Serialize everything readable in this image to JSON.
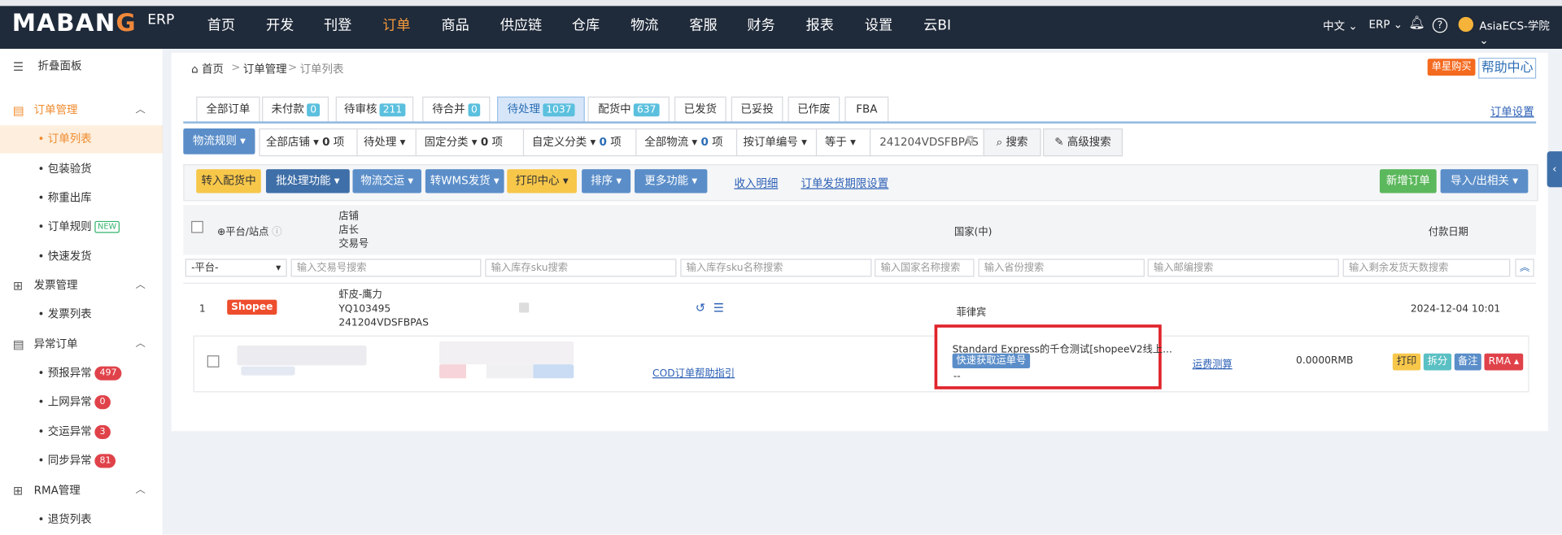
{
  "header": {
    "logo_text": "MABANG",
    "logo_suffix": "ERP",
    "nav": [
      "首页",
      "开发",
      "刊登",
      "订单",
      "商品",
      "供应链",
      "仓库",
      "物流",
      "客服",
      "财务",
      "报表",
      "设置",
      "云BI"
    ],
    "active_nav": "订单",
    "lang": "中文",
    "erp_menu": "ERP",
    "user": "AsiaECS-学院"
  },
  "sidebar": {
    "collapse_label": "折叠面板",
    "groups": [
      {
        "label": "订单管理",
        "items": [
          "订单列表",
          "包装验货",
          "称重出库",
          "订单规则",
          "快速发货"
        ],
        "new_tag": "NEW"
      },
      {
        "label": "发票管理",
        "items": [
          "发票列表"
        ]
      },
      {
        "label": "异常订单",
        "items": [
          {
            "label": "预报异常",
            "count": "497"
          },
          {
            "label": "上网异常",
            "count": "0"
          },
          {
            "label": "交运异常",
            "count": "3"
          },
          {
            "label": "同步异常",
            "count": "81"
          }
        ]
      },
      {
        "label": "RMA管理",
        "items": [
          "退货列表"
        ]
      }
    ]
  },
  "breadcrumb": [
    "首页",
    "订单管理",
    "订单列表"
  ],
  "top_actions": {
    "buy_label": "单星购买",
    "help_label": "帮助中心"
  },
  "tabs": [
    {
      "label": "全部订单"
    },
    {
      "label": "未付款",
      "count": "0"
    },
    {
      "label": "待审核",
      "count": "211"
    },
    {
      "label": "待合并",
      "count": "0"
    },
    {
      "label": "待处理",
      "count": "1037"
    },
    {
      "label": "配货中",
      "count": "637"
    },
    {
      "label": "已发货"
    },
    {
      "label": "已妥投"
    },
    {
      "label": "已作废"
    },
    {
      "label": "FBA"
    }
  ],
  "order_settings_link": "订单设置",
  "filters": {
    "logistics_rule": "物流规则",
    "all_shops": "全部店铺",
    "shops_count": "0",
    "unit": "项",
    "status": "待处理",
    "fixed_category": "固定分类",
    "fixed_count": "0",
    "custom_category": "自定义分类",
    "custom_count": "0",
    "all_logistics": "全部物流",
    "logistics_count": "0",
    "search_by": "按订单编号",
    "operator": "等于",
    "search_value": "241204VDSFBPAS",
    "search_btn": "搜索",
    "advanced_btn": "高级搜索"
  },
  "actions": {
    "to_picking": "转入配货中",
    "batch": "批处理功能",
    "logistics_ship": "物流交运",
    "wms_ship": "转WMS发货",
    "print_center": "打印中心",
    "sort": "排序",
    "more": "更多功能",
    "income_detail": "收入明细",
    "deadline_setting": "订单发货期限设置",
    "new_order": "新增订单",
    "import_export": "导入/出相关"
  },
  "table": {
    "col_platform": "平台/站点",
    "col_shop": [
      "店铺",
      "店长",
      "交易号"
    ],
    "col_country": "国家(中)",
    "col_paydate": "付款日期",
    "filter_platform": "-平台-",
    "placeholders": [
      "输入交易号搜索",
      "输入库存sku搜索",
      "输入库存sku名称搜索",
      "输入国家名称搜索",
      "输入省份搜索",
      "输入邮编搜索",
      "输入剩余发货天数搜索"
    ]
  },
  "order": {
    "index": "1",
    "platform": "Shopee",
    "shop": "虾皮-鹰力",
    "manager": "YQ103495",
    "trade_no": "241204VDSFBPAS",
    "country": "菲律宾",
    "paid_at": "2024-12-04 10:01",
    "cod_link": "COD订单帮助指引",
    "shipping_method": "Standard Express的千仓测试[shopeeV2线上...",
    "get_tracking_btn": "快速获取运单号",
    "tracking_placeholder": "--",
    "freight_link": "运费测算",
    "amount": "0.0000RMB",
    "btn_print": "打印",
    "btn_split": "拆分",
    "btn_note": "备注",
    "btn_rma": "RMA"
  },
  "colors": {
    "accent": "#f08a2c",
    "highlight_box": "#e0242c",
    "nav_bg": "#1f2a3a"
  }
}
